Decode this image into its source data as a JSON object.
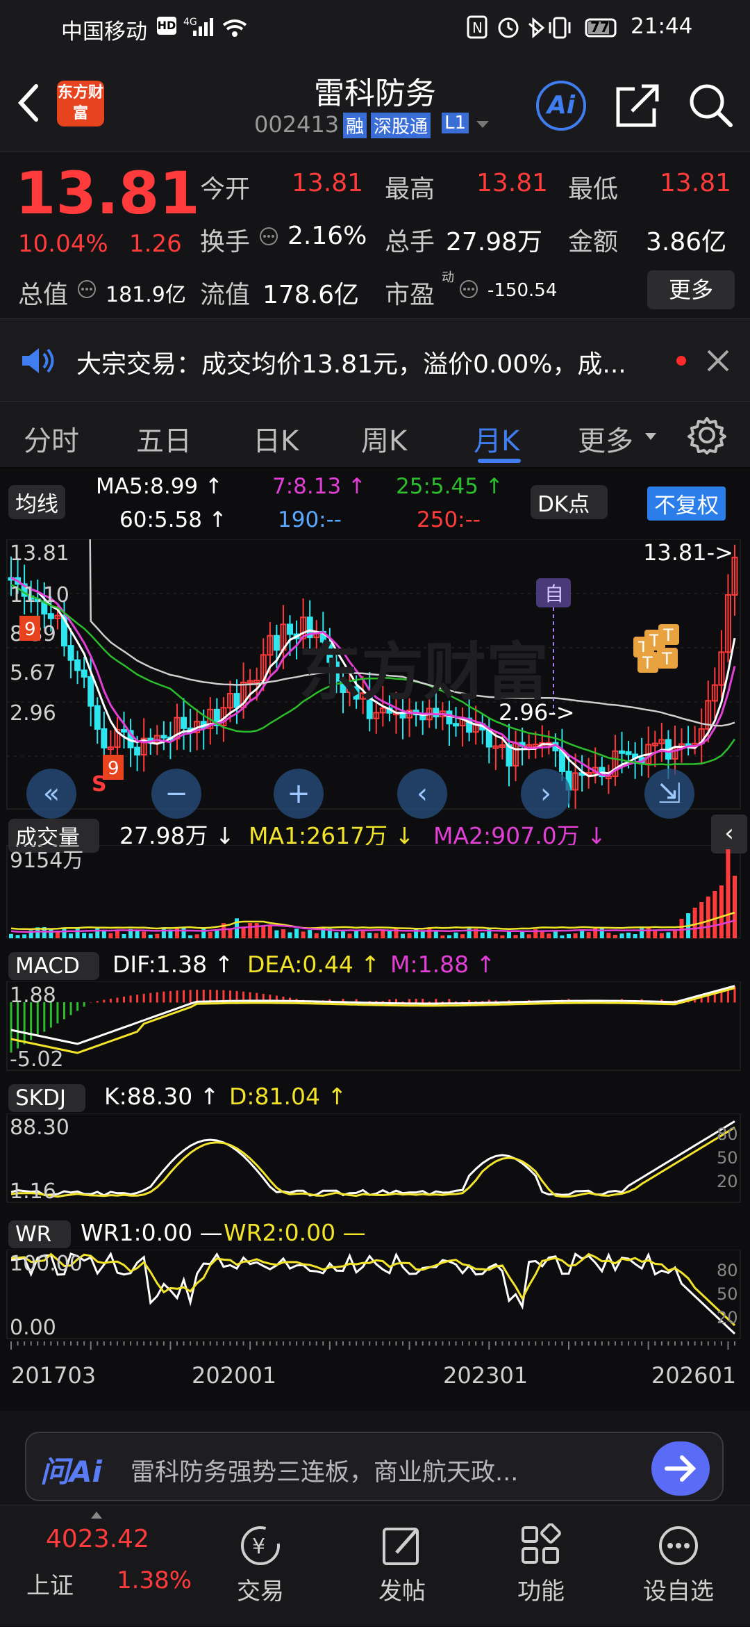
{
  "status": {
    "carrier": "中国移动",
    "time": "21:44",
    "battery": "77"
  },
  "header": {
    "logo": "东方财富",
    "title": "雷科防务",
    "code": "002413",
    "badges": [
      "融",
      "深股通",
      "L1"
    ],
    "ai_label": "Ai"
  },
  "quote": {
    "price": "13.81",
    "pct": "10.04%",
    "change": "1.26",
    "rows": [
      [
        {
          "label": "今开",
          "value": "13.81",
          "red": true
        },
        {
          "label": "最高",
          "value": "13.81",
          "red": true
        },
        {
          "label": "最低",
          "value": "13.81",
          "red": true
        }
      ],
      [
        {
          "label": "换手",
          "value": "2.16%"
        },
        {
          "label": "总手",
          "value": "27.98万"
        },
        {
          "label": "金额",
          "value": "3.86亿"
        }
      ],
      [
        {
          "label": "总值",
          "value": "181.9亿"
        },
        {
          "label": "流值",
          "value": "178.6亿"
        },
        {
          "label": "市盈",
          "sup": "动",
          "value": "-150.54"
        }
      ]
    ],
    "more_button": "更多"
  },
  "notice": {
    "text": "大宗交易：成交均价13.81元，溢价0.00%，成..."
  },
  "tabs": [
    "分时",
    "五日",
    "日K",
    "周K",
    "月K",
    "更多"
  ],
  "active_tab": 4,
  "ma_bar": {
    "selector": "均线",
    "items": [
      {
        "text": "MA5:8.99 ↑",
        "color": "#ffffff"
      },
      {
        "text": "7:8.13 ↑",
        "color": "#e23fd6"
      },
      {
        "text": "25:5.45 ↑",
        "color": "#2bbd2b"
      },
      {
        "text": "60:5.58 ↑",
        "color": "#ffffff"
      },
      {
        "text": "190:--",
        "color": "#5aa9ff"
      },
      {
        "text": "250:--",
        "color": "#ff3b3b"
      }
    ],
    "dk_button": "DK点",
    "adjust_button": "不复权"
  },
  "kline": {
    "y_labels": [
      "13.81",
      "11.10",
      "8.39",
      "5.67",
      "2.96"
    ],
    "high_tag": "13.81->",
    "low_tag": "2.96->",
    "watermark": "东方财富",
    "marker_zi": "自",
    "tag_9a": "9",
    "tag_9b": "9",
    "tag_s": "S"
  },
  "volume": {
    "selector": "成交量",
    "v": "27.98万 ↓",
    "ma1": "MA1:2617万 ↓",
    "ma2": "MA2:907.0万 ↓",
    "y_label": "9154万"
  },
  "macd": {
    "selector": "MACD",
    "dif": "DIF:1.38 ↑",
    "dea": "DEA:0.44 ↑",
    "m": "M:1.88 ↑",
    "y_top": "1.88",
    "y_bot": "-5.02"
  },
  "skdj": {
    "selector": "SKDJ",
    "k": "K:88.30 ↑",
    "d": "D:81.04 ↑",
    "y_top": "88.30",
    "y_bot": "1.16",
    "r_labels": [
      "80",
      "50",
      "20"
    ]
  },
  "wr": {
    "selector": "WR",
    "wr1": "WR1:0.00 —",
    "wr2": "WR2:0.00 —",
    "y_top": "100.00",
    "y_bot": "0.00",
    "r_labels": [
      "80",
      "50",
      "20"
    ]
  },
  "x_axis": [
    "201703",
    "202001",
    "202301",
    "202601"
  ],
  "colors": {
    "up": "#ff3b3b",
    "down": "#2ee6f0",
    "white": "#ffffff",
    "yellow": "#f2e32b",
    "magenta": "#e23fd6",
    "green": "#2bbd2b",
    "blue": "#2b7de9"
  },
  "ai_bar": {
    "brand": "问Ai",
    "text": "雷科防务强势三连板，商业航天政..."
  },
  "bottom_nav": {
    "index": {
      "value": "4023.42",
      "name": "上证",
      "pct": "1.38%"
    },
    "items": [
      "交易",
      "发帖",
      "功能",
      "设自选"
    ]
  }
}
